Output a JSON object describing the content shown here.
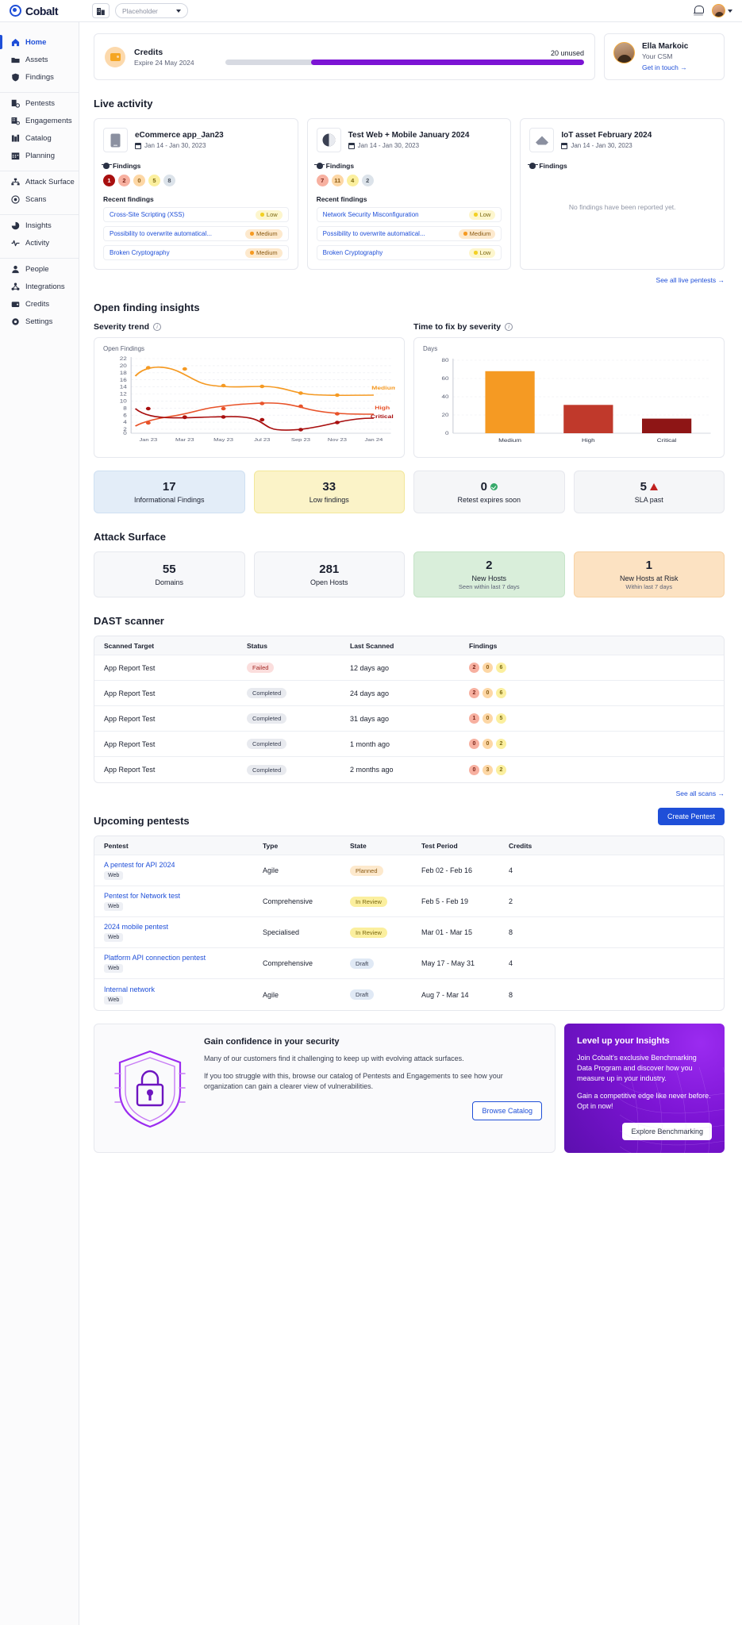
{
  "topbar": {
    "logo_text": "Cobalt",
    "org_selector_value": "Placeholder",
    "notifications_icon": "bell-icon",
    "avatar_icon": "user-avatar"
  },
  "sidebar": {
    "groups": [
      {
        "items": [
          {
            "label": "Home",
            "icon": "home-icon",
            "active": true
          },
          {
            "label": "Assets",
            "icon": "folder-icon",
            "active": false
          },
          {
            "label": "Findings",
            "icon": "shield-icon",
            "active": false
          }
        ]
      },
      {
        "items": [
          {
            "label": "Pentests",
            "icon": "pentest-icon",
            "active": false
          },
          {
            "label": "Engagements",
            "icon": "engagements-icon",
            "active": false
          },
          {
            "label": "Catalog",
            "icon": "catalog-icon",
            "active": false
          },
          {
            "label": "Planning",
            "icon": "calendar-icon",
            "active": false
          }
        ]
      },
      {
        "items": [
          {
            "label": "Attack Surface",
            "icon": "network-icon",
            "active": false
          },
          {
            "label": "Scans",
            "icon": "target-icon",
            "active": false
          }
        ]
      },
      {
        "items": [
          {
            "label": "Insights",
            "icon": "piechart-icon",
            "active": false
          },
          {
            "label": "Activity",
            "icon": "pulse-icon",
            "active": false
          }
        ]
      },
      {
        "items": [
          {
            "label": "People",
            "icon": "people-icon",
            "active": false
          },
          {
            "label": "Integrations",
            "icon": "integrations-icon",
            "active": false
          },
          {
            "label": "Credits",
            "icon": "credits-icon",
            "active": false
          },
          {
            "label": "Settings",
            "icon": "gear-icon",
            "active": false
          }
        ]
      }
    ]
  },
  "credits": {
    "title": "Credits",
    "expiry": "Expire 24 May 2024",
    "unused": "20 unused",
    "bar_used_pct": 22,
    "bar_unused_pct": 70,
    "fill_color": "#7c14d4"
  },
  "csm": {
    "name": "Ella Markoic",
    "role": "Your CSM",
    "link": "Get in touch →"
  },
  "live_activity": {
    "heading": "Live activity",
    "see_all": "See all live pentests →",
    "cards": [
      {
        "name": "eCommerce app_Jan23",
        "dates": "Jan 14 - Jan 30, 2023",
        "thumb": "mobile-icon",
        "findings_label": "Findings",
        "severity_counts": [
          {
            "value": "1",
            "bg": "#a80f0f",
            "fg": "#ffffff"
          },
          {
            "value": "2",
            "bg": "#f7b0a0",
            "fg": "#7a2318"
          },
          {
            "value": "0",
            "bg": "#fdd7a5",
            "fg": "#8a5a12"
          },
          {
            "value": "5",
            "bg": "#fbef9e",
            "fg": "#7d6a12"
          },
          {
            "value": "8",
            "bg": "#dce3ea",
            "fg": "#49525f"
          }
        ],
        "recent_label": "Recent findings",
        "findings": [
          {
            "name": "Cross-Site Scripting (XSS)",
            "severity": "Low",
            "dot": "#f2d024",
            "bg": "#fdf6cd"
          },
          {
            "name": "Possibility to overwrite automatical...",
            "severity": "Medium",
            "dot": "#f59a23",
            "bg": "#fde9cd"
          },
          {
            "name": "Broken Cryptography",
            "severity": "Medium",
            "dot": "#f59a23",
            "bg": "#fde9cd"
          }
        ]
      },
      {
        "name": "Test Web + Mobile January 2024",
        "dates": "Jan 14 - Jan 30, 2023",
        "thumb": "globe-icon",
        "findings_label": "Findings",
        "severity_counts": [
          {
            "value": "7",
            "bg": "#f7b0a0",
            "fg": "#7a2318"
          },
          {
            "value": "11",
            "bg": "#fdd7a5",
            "fg": "#8a5a12"
          },
          {
            "value": "4",
            "bg": "#fbef9e",
            "fg": "#7d6a12"
          },
          {
            "value": "2",
            "bg": "#dce3ea",
            "fg": "#49525f"
          }
        ],
        "recent_label": "Recent findings",
        "findings": [
          {
            "name": "Network Security Misconfiguration",
            "severity": "Low",
            "dot": "#f2d024",
            "bg": "#fdf6cd"
          },
          {
            "name": "Possibility to overwrite automatical...",
            "severity": "Medium",
            "dot": "#f59a23",
            "bg": "#fde9cd"
          },
          {
            "name": "Broken Cryptography",
            "severity": "Low",
            "dot": "#f2d024",
            "bg": "#fdf6cd"
          }
        ]
      },
      {
        "name": "IoT asset February 2024",
        "dates": "Jan 14 - Jan 30, 2023",
        "thumb": "iot-icon",
        "findings_label": "Findings",
        "severity_counts": [],
        "recent_label": "",
        "empty_message": "No findings have been reported yet.",
        "findings": []
      }
    ]
  },
  "insights": {
    "heading": "Open finding insights",
    "severity_trend_title": "Severity trend",
    "time_to_fix_title": "Time to fix by severity"
  },
  "chart_data": [
    {
      "type": "line",
      "title": "Severity trend",
      "ylabel": "Open Findings",
      "xlabel": "",
      "ylim": [
        0,
        22
      ],
      "yticks": [
        0,
        2,
        4,
        6,
        8,
        10,
        12,
        14,
        16,
        18,
        20,
        22
      ],
      "categories": [
        "Jan 23",
        "Mar 23",
        "May 23",
        "Jul 23",
        "Sep 23",
        "Nov 23",
        "Jan 24"
      ],
      "grid": true,
      "legend_position": "right-inline",
      "series": [
        {
          "name": "Medium",
          "color": "#f59a23",
          "values": [
            19.7,
            19.4,
            17.1,
            16.6,
            15.0,
            14.3,
            14.3
          ]
        },
        {
          "name": "High",
          "color": "#e8532a",
          "values": [
            4.6,
            5.8,
            6.7,
            7.4,
            7.7,
            6.5,
            6.5
          ]
        },
        {
          "name": "Critical",
          "color": "#a80f0f",
          "values": [
            8.0,
            5.8,
            5.3,
            5.5,
            4.3,
            1.6,
            4.3
          ]
        }
      ]
    },
    {
      "type": "bar",
      "title": "Time to fix by severity",
      "ylabel": "Days",
      "xlabel": "",
      "ylim": [
        0,
        80
      ],
      "yticks": [
        0,
        20,
        40,
        60,
        80
      ],
      "categories": [
        "Medium",
        "High",
        "Critical"
      ],
      "values": [
        68,
        31,
        16
      ],
      "colors": [
        "#f59a23",
        "#c0392b",
        "#8e1515"
      ],
      "grid": true
    }
  ],
  "finding_stats": [
    {
      "value": "17",
      "label": "Informational Findings",
      "bg": "#e3edf8",
      "border": "#cfe0f2"
    },
    {
      "value": "33",
      "label": "Low findings",
      "bg": "#fbf3c8",
      "border": "#f2e79a"
    },
    {
      "value": "0",
      "label": "Retest expires soon",
      "bg": "#f5f6f8",
      "border": "#e6e8ee",
      "icon": "check-icon"
    },
    {
      "value": "5",
      "label": "SLA past",
      "bg": "#f5f6f8",
      "border": "#e6e8ee",
      "icon": "warning-icon"
    }
  ],
  "attack_surface": {
    "heading": "Attack Surface",
    "cards": [
      {
        "value": "55",
        "label": "Domains",
        "sub": "",
        "bg": "#f7f8fa",
        "border": "#e6e8ee"
      },
      {
        "value": "281",
        "label": "Open Hosts",
        "sub": "",
        "bg": "#f7f8fa",
        "border": "#e6e8ee"
      },
      {
        "value": "2",
        "label": "New Hosts",
        "sub": "Seen within last 7 days",
        "bg": "#d9eeda",
        "border": "#c6e4c8"
      },
      {
        "value": "1",
        "label": "New Hosts at Risk",
        "sub": "Within last 7 days",
        "bg": "#fce2c2",
        "border": "#f7d2a5"
      }
    ]
  },
  "dast": {
    "heading": "DAST scanner",
    "see_all": "See all scans →",
    "columns": [
      "Scanned Target",
      "Status",
      "Last Scanned",
      "Findings"
    ],
    "rows": [
      {
        "target": "App Report Test",
        "status": "Failed",
        "status_bg": "#fbdedd",
        "status_fg": "#a32a25",
        "last_scanned": "12 days ago",
        "findings": [
          {
            "value": "2",
            "bg": "#f7b0a0",
            "fg": "#7a2318"
          },
          {
            "value": "0",
            "bg": "#fdd7a5",
            "fg": "#8a5a12"
          },
          {
            "value": "6",
            "bg": "#fbef9e",
            "fg": "#7d6a12"
          }
        ]
      },
      {
        "target": "App Report Test",
        "status": "Completed",
        "status_bg": "#e8eaef",
        "status_fg": "#3a4052",
        "last_scanned": "24 days ago",
        "findings": [
          {
            "value": "2",
            "bg": "#f7b0a0",
            "fg": "#7a2318"
          },
          {
            "value": "0",
            "bg": "#fdd7a5",
            "fg": "#8a5a12"
          },
          {
            "value": "6",
            "bg": "#fbef9e",
            "fg": "#7d6a12"
          }
        ]
      },
      {
        "target": "App Report Test",
        "status": "Completed",
        "status_bg": "#e8eaef",
        "status_fg": "#3a4052",
        "last_scanned": "31 days ago",
        "findings": [
          {
            "value": "1",
            "bg": "#f7b0a0",
            "fg": "#7a2318"
          },
          {
            "value": "0",
            "bg": "#fdd7a5",
            "fg": "#8a5a12"
          },
          {
            "value": "5",
            "bg": "#fbef9e",
            "fg": "#7d6a12"
          }
        ]
      },
      {
        "target": "App Report Test",
        "status": "Completed",
        "status_bg": "#e8eaef",
        "status_fg": "#3a4052",
        "last_scanned": "1 month ago",
        "findings": [
          {
            "value": "0",
            "bg": "#f7b0a0",
            "fg": "#7a2318"
          },
          {
            "value": "0",
            "bg": "#fdd7a5",
            "fg": "#8a5a12"
          },
          {
            "value": "2",
            "bg": "#fbef9e",
            "fg": "#7d6a12"
          }
        ]
      },
      {
        "target": "App Report Test",
        "status": "Completed",
        "status_bg": "#e8eaef",
        "status_fg": "#3a4052",
        "last_scanned": "2 months ago",
        "findings": [
          {
            "value": "0",
            "bg": "#f7b0a0",
            "fg": "#7a2318"
          },
          {
            "value": "3",
            "bg": "#fdd7a5",
            "fg": "#8a5a12"
          },
          {
            "value": "2",
            "bg": "#fbef9e",
            "fg": "#7d6a12"
          }
        ]
      }
    ]
  },
  "pentests": {
    "heading": "Upcoming pentests",
    "create_button": "Create Pentest",
    "columns": [
      "Pentest",
      "Type",
      "State",
      "Test Period",
      "Credits"
    ],
    "rows": [
      {
        "name": "A pentest for API 2024",
        "tag": "Web",
        "type": "Agile",
        "state": "Planned",
        "state_bg": "#fde9cd",
        "state_fg": "#8a5a12",
        "period": "Feb 02 - Feb 16",
        "credits": "4"
      },
      {
        "name": "Pentest for Network test",
        "tag": "Web",
        "type": "Comprehensive",
        "state": "In Review",
        "state_bg": "#fbef9e",
        "state_fg": "#7d6a12",
        "period": "Feb 5 - Feb 19",
        "credits": "2"
      },
      {
        "name": "2024 mobile pentest",
        "tag": "Web",
        "type": "Specialised",
        "state": "In Review",
        "state_bg": "#fbef9e",
        "state_fg": "#7d6a12",
        "period": "Mar 01 - Mar 15",
        "credits": "8"
      },
      {
        "name": "Platform API connection pentest",
        "tag": "Web",
        "type": "Comprehensive",
        "state": "Draft",
        "state_bg": "#e0e9f5",
        "state_fg": "#3a4052",
        "period": "May 17 - May 31",
        "credits": "4"
      },
      {
        "name": "Internal network",
        "tag": "Web",
        "type": "Agile",
        "state": "Draft",
        "state_bg": "#e0e9f5",
        "state_fg": "#3a4052",
        "period": "Aug 7 - Mar 14",
        "credits": "8"
      }
    ]
  },
  "promos": {
    "left": {
      "title": "Gain confidence in your security",
      "p1": "Many of our customers find it challenging to keep up with evolving attack surfaces.",
      "p2": "If you too struggle with this, browse our catalog of Pentests and Engagements to see how your organization can gain a clearer view of vulnerabilities.",
      "button": "Browse Catalog",
      "art": "shield-lock-illustration"
    },
    "right": {
      "title": "Level up your Insights",
      "p1": "Join Cobalt's exclusive Benchmarking Data Program and discover how you measure up in your industry.",
      "p2": "Gain a competitive edge like never before. Opt in now!",
      "button": "Explore Benchmarking"
    }
  }
}
